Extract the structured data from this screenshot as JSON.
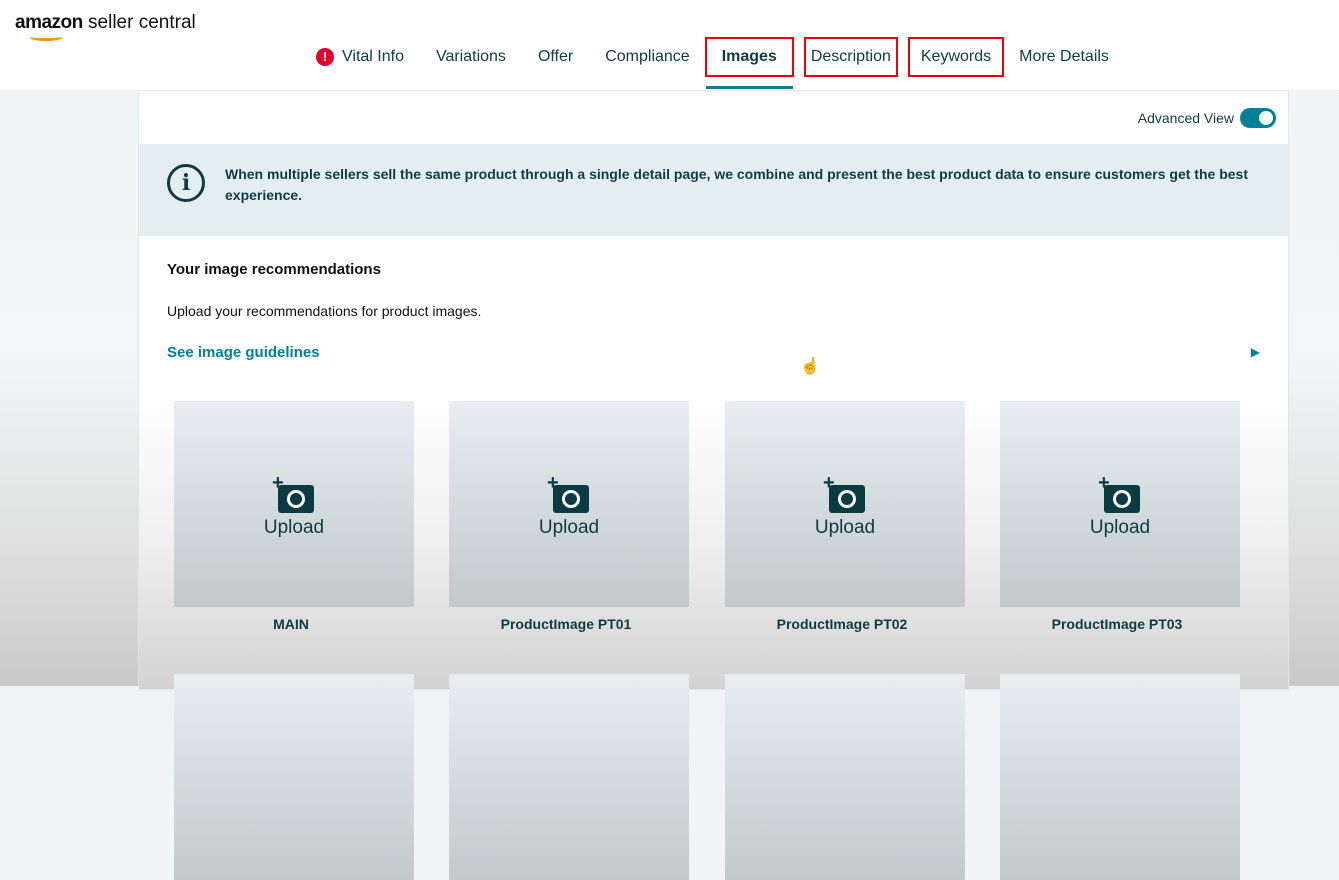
{
  "logo": {
    "brand": "amazon",
    "product": "seller central"
  },
  "tabs": [
    {
      "label": "Vital Info",
      "alert": "!"
    },
    {
      "label": "Variations"
    },
    {
      "label": "Offer"
    },
    {
      "label": "Compliance"
    },
    {
      "label": "Images"
    },
    {
      "label": "Description"
    },
    {
      "label": "Keywords"
    },
    {
      "label": "More Details"
    }
  ],
  "advanced_view": {
    "label": "Advanced View",
    "on": true
  },
  "info": {
    "icon": "i",
    "text": "When multiple sellers sell the same product through a single detail page, we combine and present the best product data to ensure customers get the best experience."
  },
  "section": {
    "title": "Your image recommendations",
    "subtitle": "Upload your recommendations for product images.",
    "link": "See image guidelines"
  },
  "slots": [
    {
      "upload": "Upload",
      "label": "MAIN"
    },
    {
      "upload": "Upload",
      "label": "ProductImage PT01"
    },
    {
      "upload": "Upload",
      "label": "ProductImage PT02"
    },
    {
      "upload": "Upload",
      "label": "ProductImage PT03"
    }
  ],
  "colors": {
    "accent": "#008296",
    "highlight": "#e00000"
  }
}
